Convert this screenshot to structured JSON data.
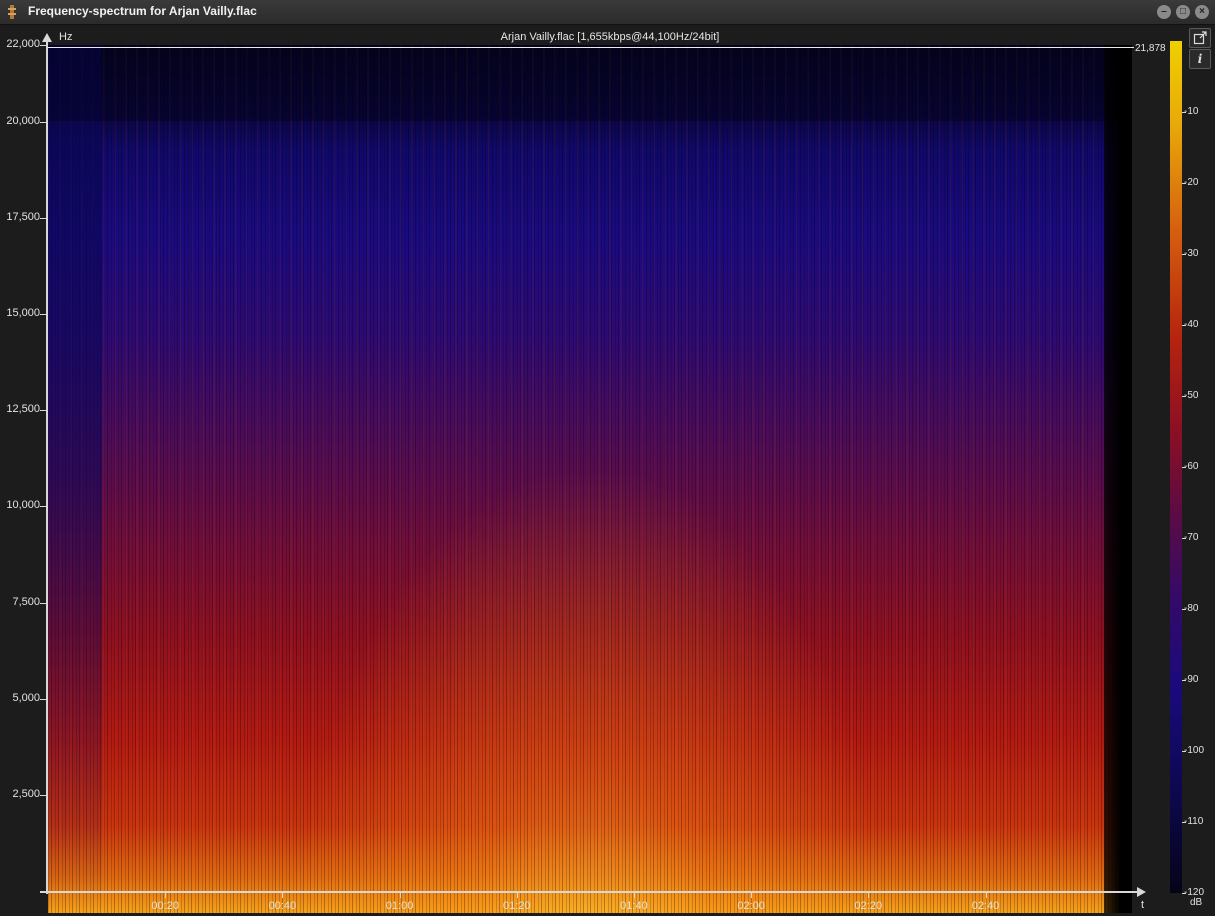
{
  "window": {
    "title": "Frequency-spectrum for Arjan Vailly.flac",
    "minimize_icon": "minimize-icon",
    "maximize_icon": "maximize-icon",
    "close_icon": "close-icon"
  },
  "chart_data": {
    "type": "heatmap",
    "title": "Arjan Vailly.flac [1,655kbps@44,100Hz/24bit]",
    "ylabel": "Hz",
    "xlabel": "t",
    "y_ticks": [
      "22,000",
      "20,000",
      "17,500",
      "15,000",
      "12,500",
      "10,000",
      "7,500",
      "5,000",
      "2,500"
    ],
    "y_tick_values": [
      22000,
      20000,
      17500,
      15000,
      12500,
      10000,
      7500,
      5000,
      2500
    ],
    "x_ticks": [
      "00:20",
      "00:40",
      "01:00",
      "01:20",
      "01:40",
      "02:00",
      "02:20",
      "02:40"
    ],
    "x_tick_seconds": [
      20,
      40,
      60,
      80,
      100,
      120,
      140,
      160
    ],
    "ylim": [
      0,
      22000
    ],
    "xlim_seconds": [
      0,
      185
    ],
    "cutoff_label": "21,878",
    "cutoff_value": 21878,
    "colorbar": {
      "unit": "dB",
      "ticks": [
        "-10",
        "-20",
        "-30",
        "-40",
        "-50",
        "-60",
        "-70",
        "-80",
        "-90",
        "-100",
        "-110",
        "-120"
      ],
      "tick_values": [
        -10,
        -20,
        -30,
        -40,
        -50,
        -60,
        -70,
        -80,
        -90,
        -100,
        -110,
        -120
      ],
      "range": [
        0,
        -120
      ],
      "colors": [
        "#f0d000",
        "#d6600e",
        "#b5230f",
        "#5a0b46",
        "#1a0a7c",
        "#050318"
      ]
    }
  },
  "toolbar": {
    "export_icon": "export-icon",
    "info_icon": "info-icon",
    "info_label": "i"
  }
}
